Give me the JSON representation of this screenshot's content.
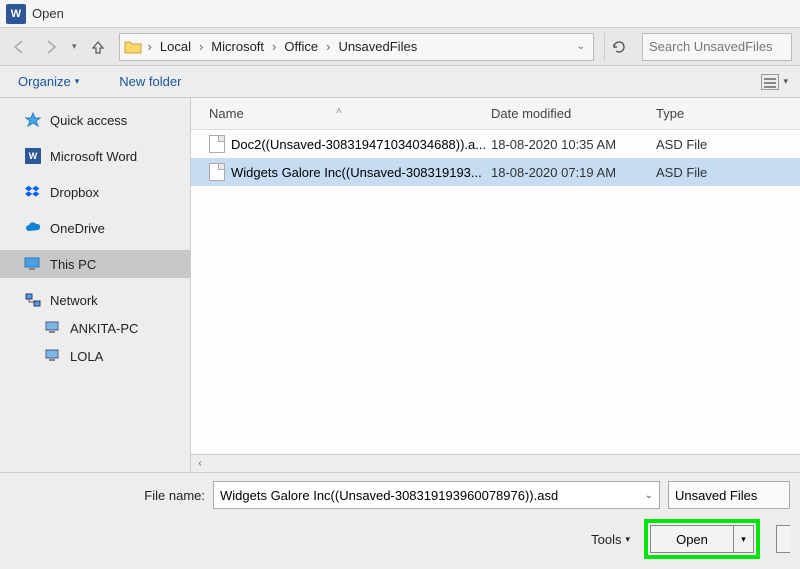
{
  "title": "Open",
  "breadcrumbs": [
    "Local",
    "Microsoft",
    "Office",
    "UnsavedFiles"
  ],
  "search_placeholder": "Search UnsavedFiles",
  "toolbar": {
    "organize": "Organize",
    "newfolder": "New folder"
  },
  "sidebar": {
    "quick_access": "Quick access",
    "word": "Microsoft Word",
    "dropbox": "Dropbox",
    "onedrive": "OneDrive",
    "this_pc": "This PC",
    "network": "Network",
    "net_children": [
      "ANKITA-PC",
      "LOLA"
    ]
  },
  "columns": {
    "name": "Name",
    "date": "Date modified",
    "type": "Type"
  },
  "files": [
    {
      "name": "Doc2((Unsaved-308319471034034688)).a...",
      "date": "18-08-2020 10:35 AM",
      "type": "ASD File",
      "selected": false
    },
    {
      "name": "Widgets Galore Inc((Unsaved-308319193...",
      "date": "18-08-2020 07:19 AM",
      "type": "ASD File",
      "selected": true
    }
  ],
  "filename_label": "File name:",
  "filename_value": "Widgets Galore Inc((Unsaved-308319193960078976)).asd",
  "filter_value": "Unsaved Files",
  "tools_label": "Tools",
  "open_label": "Open"
}
